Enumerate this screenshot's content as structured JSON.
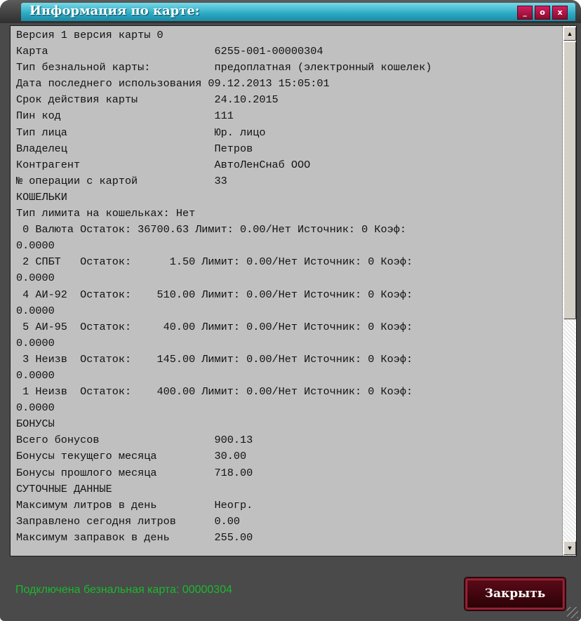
{
  "window": {
    "title": "Информация по карте:",
    "buttons": {
      "minimize": "_",
      "maximize": "o",
      "close": "x"
    }
  },
  "content": {
    "lines": [
      "Версия 1 версия карты 0",
      "Карта                          6255-001-00000304",
      "Тип безнальной карты:          предоплатная (электронный кошелек)",
      "Дата последнего использования 09.12.2013 15:05:01",
      "Срок действия карты            24.10.2015",
      "Пин код                        111",
      "Тип лица                       Юр. лицо",
      "Владелец                       Петров",
      "Контрагент                     АвтоЛенСнаб ООО",
      "№ операции с картой            33",
      "КОШЕЛЬКИ",
      "Тип лимита на кошельках: Нет",
      " 0 Валюта Остаток: 36700.63 Лимит: 0.00/Нет Источник: 0 Коэф:",
      "0.0000",
      " 2 СПБТ   Остаток:      1.50 Лимит: 0.00/Нет Источник: 0 Коэф:",
      "0.0000",
      " 4 АИ-92  Остаток:    510.00 Лимит: 0.00/Нет Источник: 0 Коэф:",
      "0.0000",
      " 5 АИ-95  Остаток:     40.00 Лимит: 0.00/Нет Источник: 0 Коэф:",
      "0.0000",
      " 3 Неизв  Остаток:    145.00 Лимит: 0.00/Нет Источник: 0 Коэф:",
      "0.0000",
      " 1 Неизв  Остаток:    400.00 Лимит: 0.00/Нет Источник: 0 Коэф:",
      "0.0000",
      "БОНУСЫ",
      "Всего бонусов                  900.13",
      "Бонусы текущего месяца         30.00",
      "Бонусы прошлого месяца         718.00",
      "СУТОЧНЫЕ ДАННЫЕ",
      "Максимум литров в день         Неогр.",
      "Заправлено сегодня литров      0.00",
      "Максимум заправок в день       255.00"
    ],
    "scrollbar": {
      "up_arrow": "▲",
      "down_arrow": "▼",
      "position": 0.0
    }
  },
  "footer": {
    "status": "Подключена безнальная карта: 00000304",
    "close_label": "Закрыть"
  },
  "colors": {
    "status_text": "#1bb82e",
    "title_bar": "#2aa9c3",
    "content_bg": "#c0c0c0",
    "close_button": "#5a0a18"
  }
}
